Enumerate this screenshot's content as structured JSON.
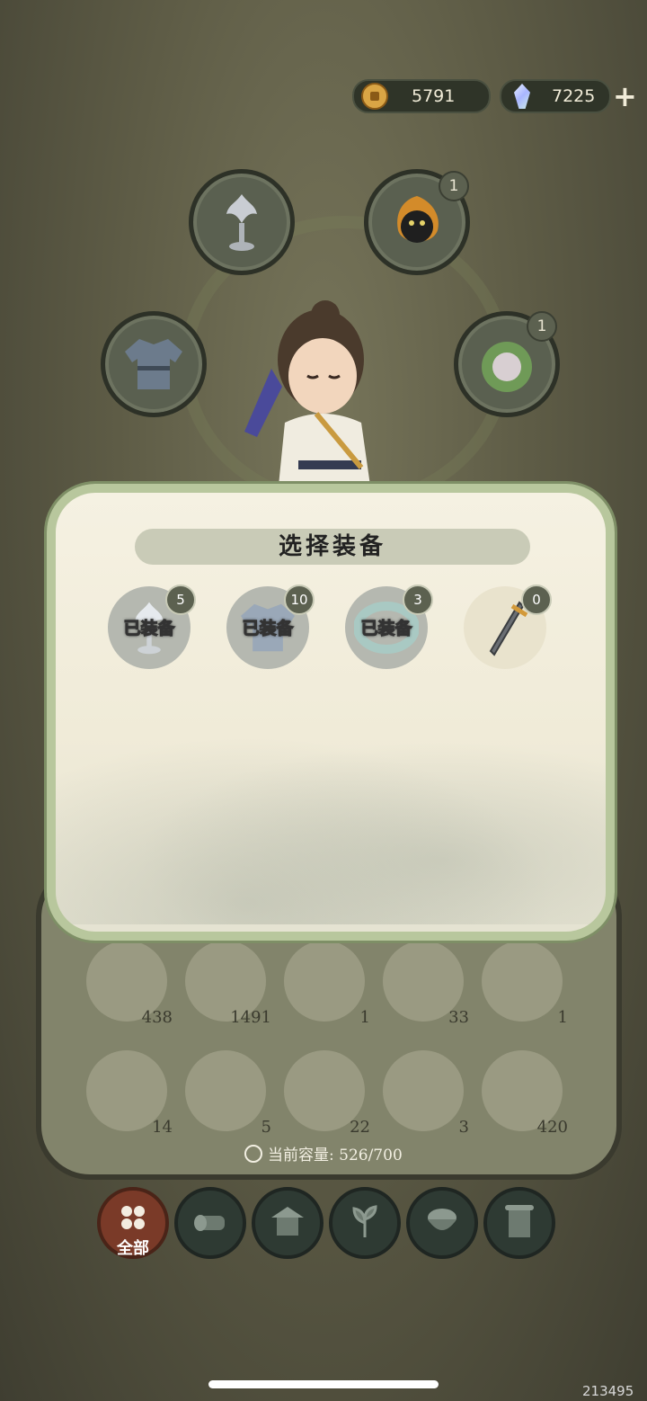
{
  "currency": {
    "coins": "5791",
    "gems": "7225"
  },
  "slots": [
    {
      "name": "accessory-slot",
      "badge": null
    },
    {
      "name": "pet-slot",
      "badge": "1"
    },
    {
      "name": "armor-slot",
      "badge": null
    },
    {
      "name": "companion-slot",
      "badge": "1"
    }
  ],
  "modal": {
    "title": "选择装备",
    "items": [
      {
        "label": "已装备",
        "count": "5"
      },
      {
        "label": "已装备",
        "count": "10"
      },
      {
        "label": "已装备",
        "count": "3"
      },
      {
        "label": "",
        "count": "0"
      }
    ]
  },
  "inventory": {
    "row1": [
      "438",
      "1491",
      "1",
      "33",
      "1"
    ],
    "row2": [
      "14",
      "5",
      "22",
      "3",
      "420"
    ],
    "capacity_label": "当前容量: 526/700"
  },
  "tabs": {
    "all_label": "全部"
  },
  "watermark": "213495"
}
